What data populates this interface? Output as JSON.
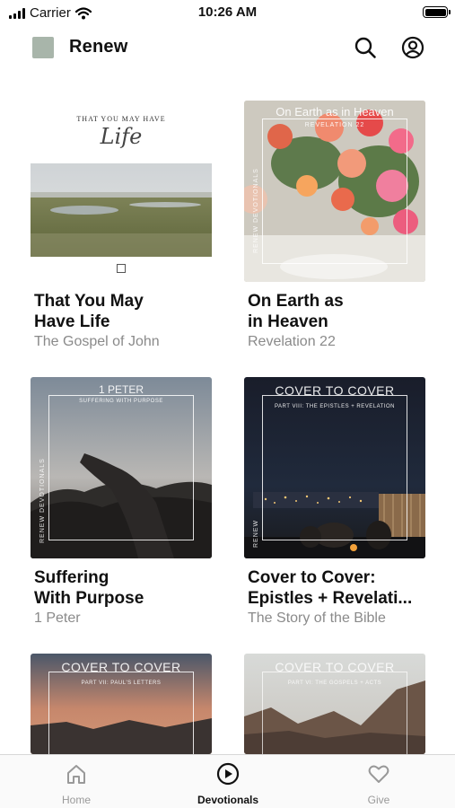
{
  "status_bar": {
    "carrier": "Carrier",
    "time": "10:26 AM"
  },
  "header": {
    "title": "Renew"
  },
  "cards": [
    {
      "title_line1": "That You May",
      "title_line2": "Have Life",
      "subtitle": "The Gospel of John",
      "cover": {
        "heading": "THAT YOU MAY HAVE",
        "script": "Life"
      }
    },
    {
      "title_line1": "On Earth as",
      "title_line2": "in Heaven",
      "subtitle": "Revelation 22",
      "cover": {
        "heading": "On Earth as in Heaven",
        "sub": "REVELATION 22",
        "vertical": "RENEW DEVOTIONALS"
      }
    },
    {
      "title_line1": "Suffering",
      "title_line2": "With Purpose",
      "subtitle": "1 Peter",
      "cover": {
        "heading": "1 PETER",
        "sub": "SUFFERING WITH PURPOSE",
        "vertical": "RENEW DEVOTIONALS"
      }
    },
    {
      "title_line1": "Cover to Cover:",
      "title_line2": "Epistles + Revelati...",
      "subtitle": "The Story of the Bible",
      "cover": {
        "heading": "COVER TO COVER",
        "sub": "PART VIII: THE EPISTLES + REVELATION",
        "vertical": "RENEW"
      }
    },
    {
      "cover": {
        "heading": "COVER TO COVER",
        "sub": "PART VII: PAUL'S LETTERS"
      }
    },
    {
      "cover": {
        "heading": "COVER TO COVER",
        "sub": "PART VI: THE GOSPELS + ACTS"
      }
    }
  ],
  "tab_bar": {
    "tabs": [
      {
        "label": "Home",
        "icon": "home-icon",
        "active": false
      },
      {
        "label": "Devotionals",
        "icon": "play-circle-icon",
        "active": true
      },
      {
        "label": "Give",
        "icon": "heart-icon",
        "active": false
      }
    ]
  },
  "colors": {
    "active_tab": "#111111",
    "inactive_tab": "#999999",
    "subtitle": "#8a8a8a"
  }
}
